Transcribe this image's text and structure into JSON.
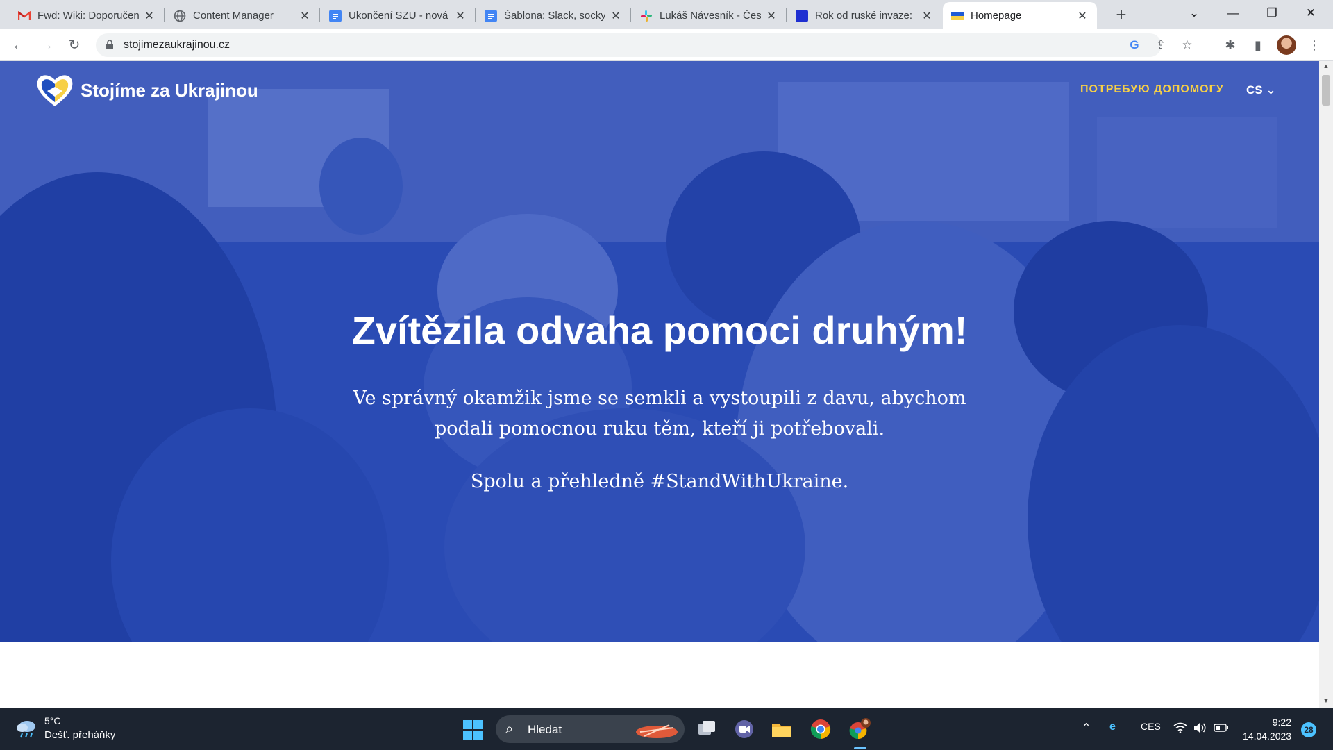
{
  "browser": {
    "tabs": [
      {
        "title": "Fwd: Wiki: Doporučen",
        "favicon": "gmail-icon"
      },
      {
        "title": "Content Manager",
        "favicon": "globe-icon"
      },
      {
        "title": "Ukončení SZU - nová",
        "favicon": "docs-icon"
      },
      {
        "title": "Šablona: Slack, socky,",
        "favicon": "docs-icon"
      },
      {
        "title": "Lukáš Návesník - Česk",
        "favicon": "slack-icon"
      },
      {
        "title": "Rok od ruské invaze:",
        "favicon": "site-icon"
      },
      {
        "title": "Homepage",
        "favicon": "ukraine-flag-icon"
      }
    ],
    "active_tab": 6,
    "url": "stojimezaukrajinou.cz",
    "colors": {
      "tabbar": "#dee1e6",
      "omnibox": "#f1f3f4"
    }
  },
  "site": {
    "brand_name": "Stojíme za Ukrajinou",
    "help_link": "ПОТРЕБУЮ ДОПОМОГУ",
    "language": "CS",
    "hero_title": "Zvítězila odvaha pomoci druhým!",
    "hero_text": "Ve správný okamžik jsme se semkli a vystoupili z davu, abychom podali pomocnou ruku těm, kteří ji potřebovali.",
    "hero_subtext": "Spolu a přehledně #StandWithUkraine.",
    "colors": {
      "hero_overlay": "#1e41be",
      "accent_yellow": "#f7d046",
      "logo_blue": "#1f4fbf"
    }
  },
  "taskbar": {
    "weather_temp": "5°C",
    "weather_desc": "Dešť. přeháňky",
    "search_label": "Hledat",
    "language": "CES",
    "time": "9:22",
    "date": "14.04.2023",
    "notification_count": "28"
  }
}
